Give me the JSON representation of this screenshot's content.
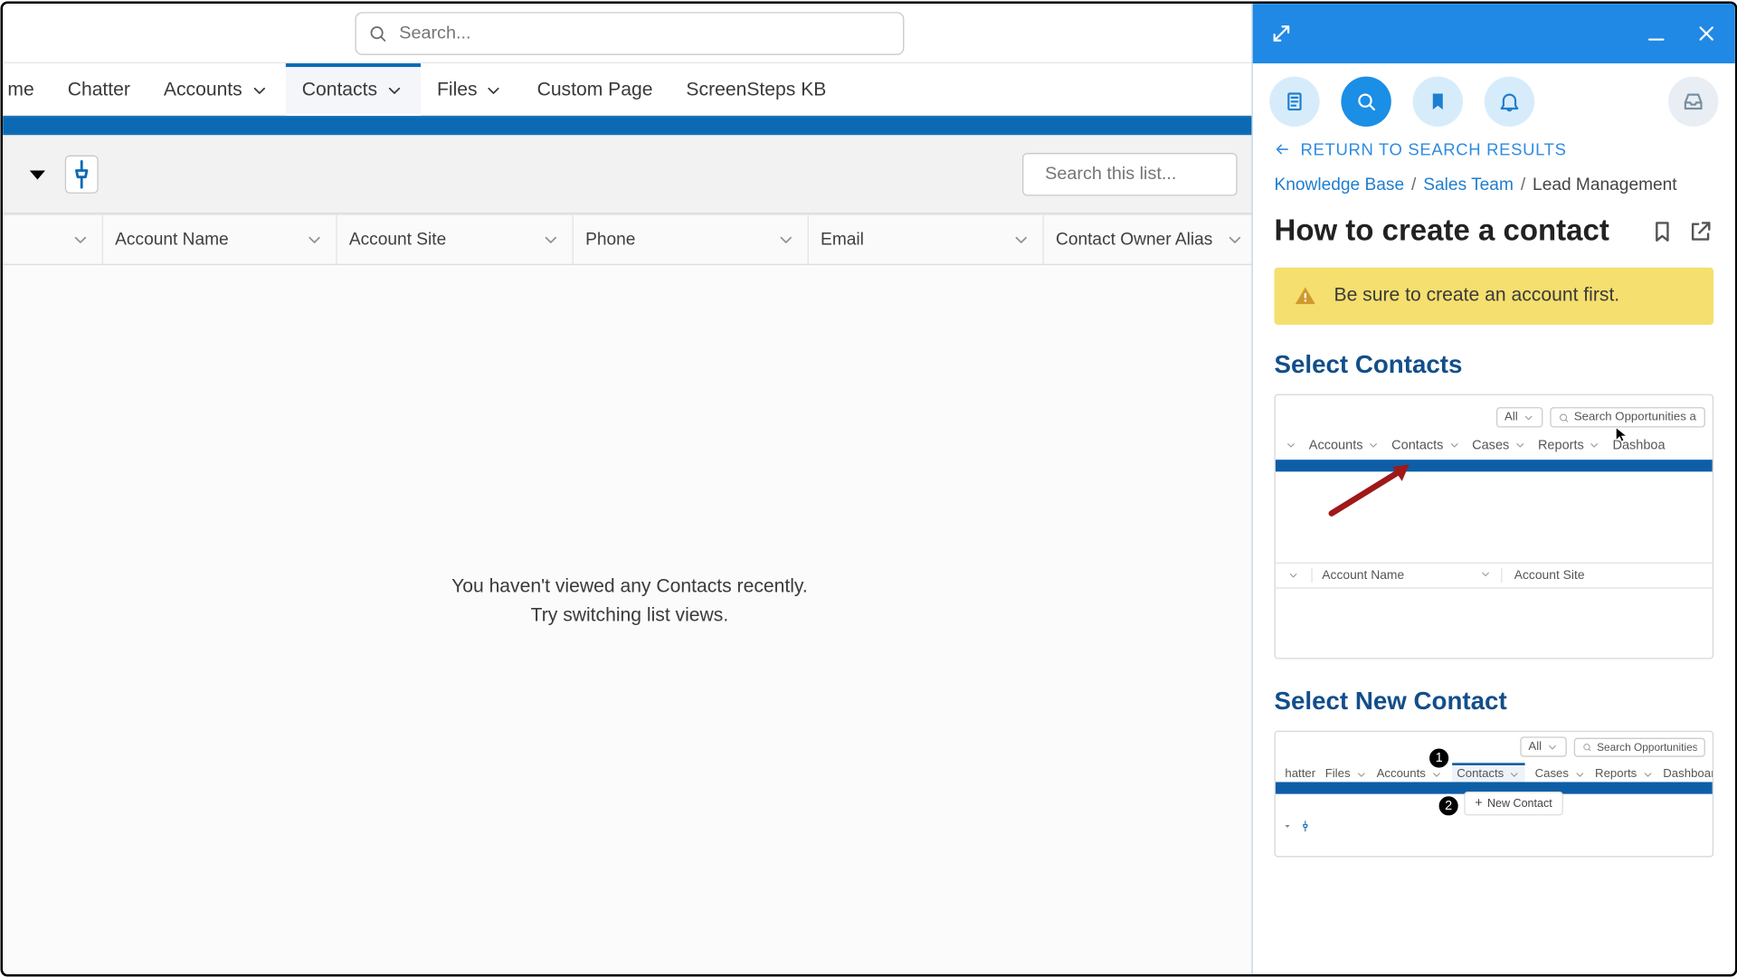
{
  "globalSearch": {
    "placeholder": "Search..."
  },
  "nav": {
    "items": [
      "me",
      "Chatter",
      "Accounts",
      "Contacts",
      "Files",
      "Custom Page",
      "ScreenSteps KB"
    ],
    "active": "Contacts"
  },
  "listSearch": {
    "placeholder": "Search this list..."
  },
  "columns": [
    "",
    "Account Name",
    "Account Site",
    "Phone",
    "Email",
    "Contact Owner Alias"
  ],
  "empty": {
    "line1": "You haven't viewed any Contacts recently.",
    "line2": "Try switching list views."
  },
  "panel": {
    "return": "RETURN TO SEARCH RESULTS",
    "breadcrumbs": {
      "root": "Knowledge Base",
      "mid": "Sales Team",
      "current": "Lead Management"
    },
    "title": "How to create a contact",
    "alert": "Be sure to create an account first.",
    "sections": {
      "s1": "Select Contacts",
      "s2": "Select New Contact"
    },
    "shot1": {
      "pillAll": "All",
      "pillSearch": "Search Opportunities and",
      "nav": [
        "Accounts",
        "Contacts",
        "Cases",
        "Reports",
        "Dashboa"
      ],
      "colA": "Account Name",
      "colB": "Account Site"
    },
    "shot2": {
      "pillAll": "All",
      "pillSearch": "Search Opportunities and",
      "nav": [
        "hatter",
        "Files",
        "Accounts",
        "Contacts",
        "Cases",
        "Reports",
        "Dashboar"
      ],
      "newContact": "New Contact"
    }
  }
}
